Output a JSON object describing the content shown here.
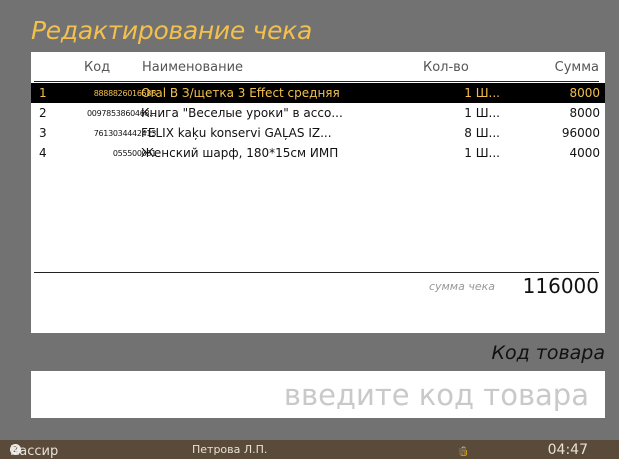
{
  "title": "Редактирование чека",
  "table": {
    "headers": {
      "code": "Код",
      "name": "Наименование",
      "qty": "Кол-во",
      "sum": "Сумма"
    },
    "rows": [
      {
        "num": "1",
        "code": "8888826016588",
        "name": "Oral B З/щетка 3 Effect средняя",
        "qty": "1 Ш...",
        "sum": "8000",
        "selected": true
      },
      {
        "num": "2",
        "code": "0097853860468...",
        "name": "Книга \"Веселые уроки\" в ассо...",
        "qty": "1 Ш...",
        "sum": "8000",
        "selected": false
      },
      {
        "num": "3",
        "code": "7613034442413",
        "name": "FELIX kaķu konservi GAĻAS IZ...",
        "qty": "8 Ш...",
        "sum": "96000",
        "selected": false
      },
      {
        "num": "4",
        "code": "055500081",
        "name": "Женский шарф, 180*15см ИМП",
        "qty": "1 Ш...",
        "sum": "4000",
        "selected": false
      }
    ]
  },
  "total": {
    "label": "сумма чека",
    "value": "116000"
  },
  "code_input": {
    "label": "Код товара",
    "placeholder": "введите код товара",
    "value": ""
  },
  "status": {
    "role_badge": "2",
    "role": "Кассир",
    "user": "Петрова Л.П.",
    "icons": [
      "lock-icon",
      "keyboard-icon",
      "printer-icon",
      "network-icon",
      "refresh-icon"
    ],
    "time": "04:47"
  },
  "colors": {
    "background": "#727272",
    "accent": "#f3c04d",
    "statusbar": "#5a4a3a"
  }
}
